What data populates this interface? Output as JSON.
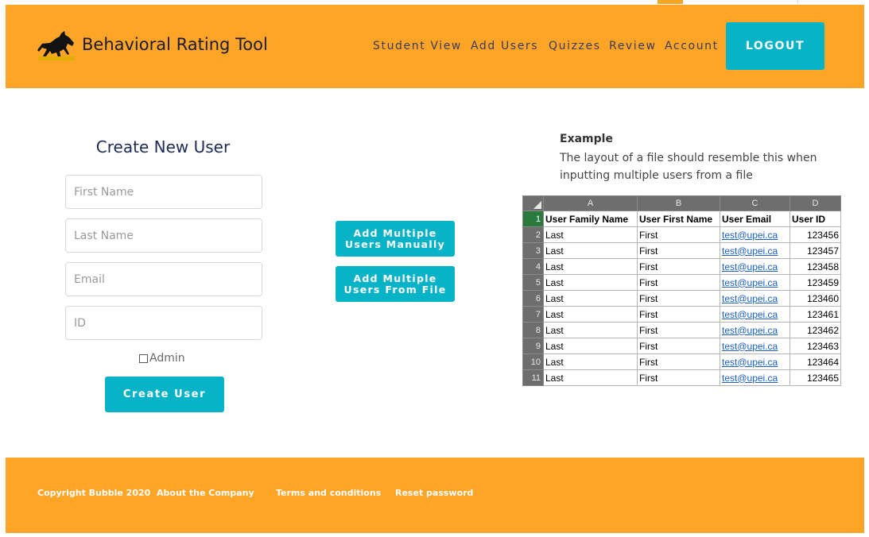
{
  "header": {
    "brand": "Behavioral Rating Tool",
    "nav": [
      "Student View",
      "Add Users",
      "Quizzes",
      "Review",
      "Account"
    ],
    "logout": "LOGOUT"
  },
  "form": {
    "title": "Create New User",
    "first_name_placeholder": "First Name",
    "last_name_placeholder": "Last Name",
    "email_placeholder": "Email",
    "id_placeholder": "ID",
    "admin_label": "Admin",
    "admin_checked": false,
    "create_button": "Create User"
  },
  "bulk": {
    "manual_button": "Add Multiple Users Manually",
    "file_button": "Add Multiple Users From File"
  },
  "example": {
    "title": "Example",
    "description": "The layout of a file should resemble this when inputting multiple users from a file",
    "sheet": {
      "columns": [
        "A",
        "B",
        "C",
        "D"
      ],
      "headers": [
        "User Family Name",
        "User First Name",
        "User Email",
        "User ID"
      ],
      "rows": [
        [
          "Last",
          "First",
          "test@upei.ca",
          "123456"
        ],
        [
          "Last",
          "First",
          "test@upei.ca",
          "123457"
        ],
        [
          "Last",
          "First",
          "test@upei.ca",
          "123458"
        ],
        [
          "Last",
          "First",
          "test@upei.ca",
          "123459"
        ],
        [
          "Last",
          "First",
          "test@upei.ca",
          "123460"
        ],
        [
          "Last",
          "First",
          "test@upei.ca",
          "123461"
        ],
        [
          "Last",
          "First",
          "test@upei.ca",
          "123462"
        ],
        [
          "Last",
          "First",
          "test@upei.ca",
          "123463"
        ],
        [
          "Last",
          "First",
          "test@upei.ca",
          "123464"
        ],
        [
          "Last",
          "First",
          "test@upei.ca",
          "123465"
        ]
      ]
    }
  },
  "footer": {
    "copyright": "Copyright Bubble 2020",
    "about": "About the Company",
    "terms": "Terms and conditions",
    "reset": "Reset password"
  },
  "colors": {
    "header_bg": "#fea528",
    "accent": "#08b3c8",
    "title": "#1c2b57"
  }
}
